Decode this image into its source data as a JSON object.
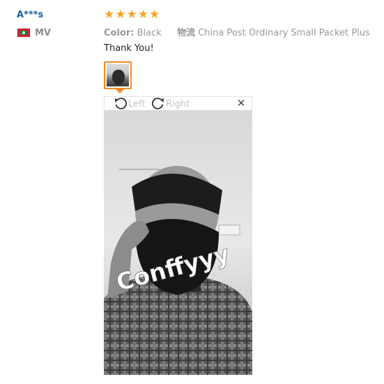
{
  "reviewer": {
    "name": "A***s",
    "country_code": "MV"
  },
  "review": {
    "rating": 5,
    "stars": [
      "★",
      "★",
      "★",
      "★",
      "★"
    ],
    "color_label": "Color:",
    "color_value": "Black",
    "logistics_label": "物流",
    "logistics_value": "China Post Ordinary Small Packet Plus",
    "text": "Thank You!"
  },
  "viewer": {
    "rotate_left_label": "Left",
    "rotate_right_label": "Right",
    "close_glyph": "✕",
    "photo_watermark": "Conffyyy"
  },
  "colors": {
    "star": "#f5a623",
    "reviewer_name": "#1e5f9f",
    "thumb_border": "#f08a24"
  }
}
